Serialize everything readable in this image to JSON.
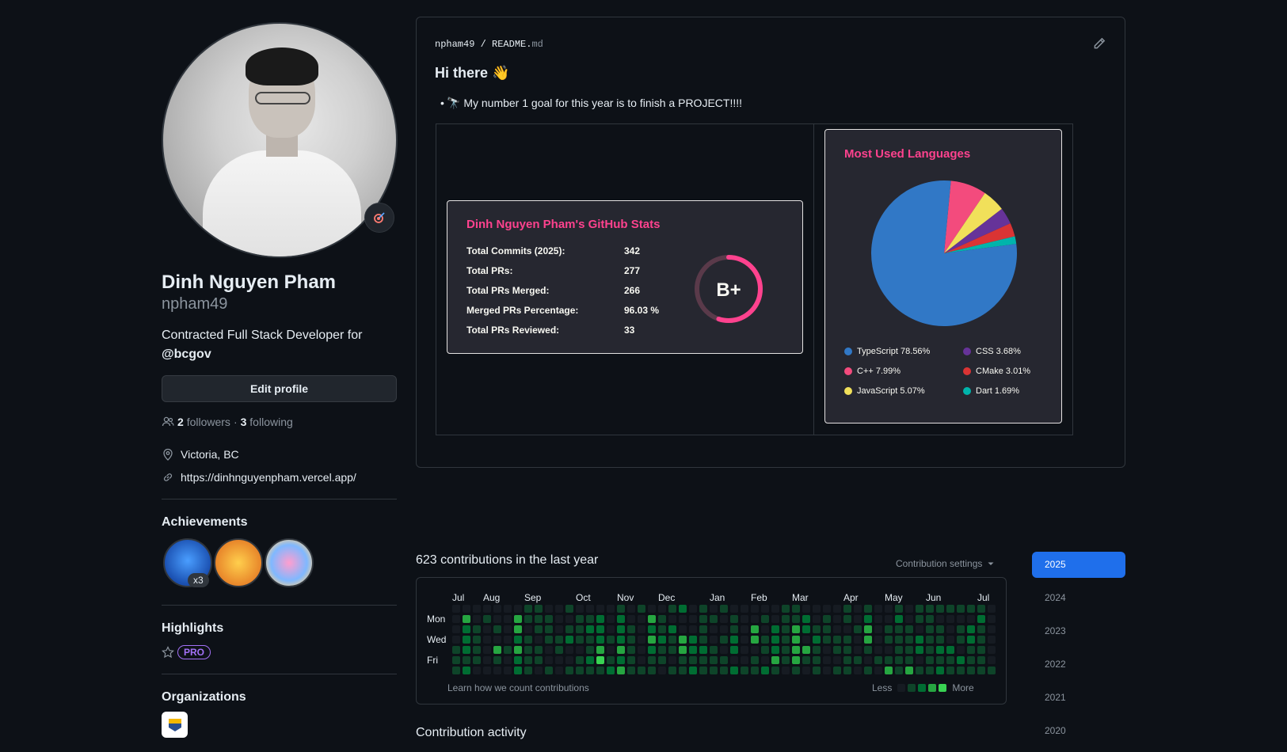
{
  "profile": {
    "full_name": "Dinh Nguyen Pham",
    "username": "npham49",
    "bio_text": "Contracted Full Stack Developer for",
    "bio_org": "@bcgov",
    "edit_label": "Edit profile",
    "followers_count": "2",
    "followers_label": "followers",
    "separator": "·",
    "following_count": "3",
    "following_label": "following",
    "location": "Victoria, BC",
    "website": "https://dinhnguyenpham.vercel.app/"
  },
  "achievements": {
    "heading": "Achievements",
    "count_badge": "x3"
  },
  "highlights": {
    "heading": "Highlights",
    "pro_label": "PRO"
  },
  "organizations": {
    "heading": "Organizations"
  },
  "readme": {
    "owner": "npham49",
    "slash": "/",
    "file_base": "README.",
    "file_ext": "md",
    "greeting": "Hi there 👋",
    "goal": "🔭 My number 1 goal for this year is to finish a PROJECT!!!!"
  },
  "stats_card": {
    "title": "Dinh Nguyen Pham's GitHub Stats",
    "rows": [
      {
        "label": "Total Commits (2025):",
        "value": "342"
      },
      {
        "label": "Total PRs:",
        "value": "277"
      },
      {
        "label": "Total PRs Merged:",
        "value": "266"
      },
      {
        "label": "Merged PRs Percentage:",
        "value": "96.03 %"
      },
      {
        "label": "Total PRs Reviewed:",
        "value": "33"
      }
    ],
    "grade": "B+",
    "grade_progress": 0.55,
    "accent_color": "#fe428e"
  },
  "chart_data": {
    "type": "pie",
    "title": "Most Used Languages",
    "slices": [
      {
        "name": "TypeScript",
        "label": "TypeScript 78.56%",
        "value": 78.56,
        "color": "#3178c6"
      },
      {
        "name": "C++",
        "label": "C++ 7.99%",
        "value": 7.99,
        "color": "#f34b7d"
      },
      {
        "name": "JavaScript",
        "label": "JavaScript 5.07%",
        "value": 5.07,
        "color": "#f1e05a"
      },
      {
        "name": "CSS",
        "label": "CSS 3.68%",
        "value": 3.68,
        "color": "#663399"
      },
      {
        "name": "CMake",
        "label": "CMake 3.01%",
        "value": 3.01,
        "color": "#da3434"
      },
      {
        "name": "Dart",
        "label": "Dart 1.69%",
        "value": 1.69,
        "color": "#00b4ab"
      }
    ],
    "legend_placement": "bottom"
  },
  "contributions": {
    "title": "623 contributions in the last year",
    "settings_label": "Contribution settings",
    "months": [
      "Jul",
      "Aug",
      "Sep",
      "Oct",
      "Nov",
      "Dec",
      "Jan",
      "Feb",
      "Mar",
      "Apr",
      "May",
      "Jun",
      "Jul"
    ],
    "days": [
      "Mon",
      "Wed",
      "Fri"
    ],
    "learn_label": "Learn how we count contributions",
    "less_label": "Less",
    "more_label": "More",
    "colors": [
      "#161b22",
      "#0e4429",
      "#006d32",
      "#26a641",
      "#39d353"
    ],
    "weeks": [
      "0000111",
      "0322212",
      "0011110",
      "0100000",
      "0010310",
      "0000100",
      "0332322",
      "1101111",
      "1110110",
      "0111001",
      "0001100",
      "1012001",
      "0111011",
      "0121121",
      "0222341",
      "0001012",
      "1222323",
      "0011111",
      "1000001",
      "0323211",
      "0112110",
      "1021101",
      "2003311",
      "0002212",
      "1111211",
      "0100111",
      "1001011",
      "0112202",
      "0000001",
      "0033011",
      "0101102",
      "0022231",
      "1111110",
      "1133331",
      "0220310",
      "0012111",
      "0111000",
      "0001101",
      "1101111",
      "0010010",
      "1233101",
      "0000010",
      "0011013",
      "1211111",
      "0011113",
      "1102201",
      "1111111",
      "1011212",
      "1000211",
      "1011021",
      "1022111",
      "1211111",
      "0000001"
    ]
  },
  "activity": {
    "title": "Contribution activity"
  },
  "years": [
    "2025",
    "2024",
    "2023",
    "2022",
    "2021",
    "2020"
  ]
}
